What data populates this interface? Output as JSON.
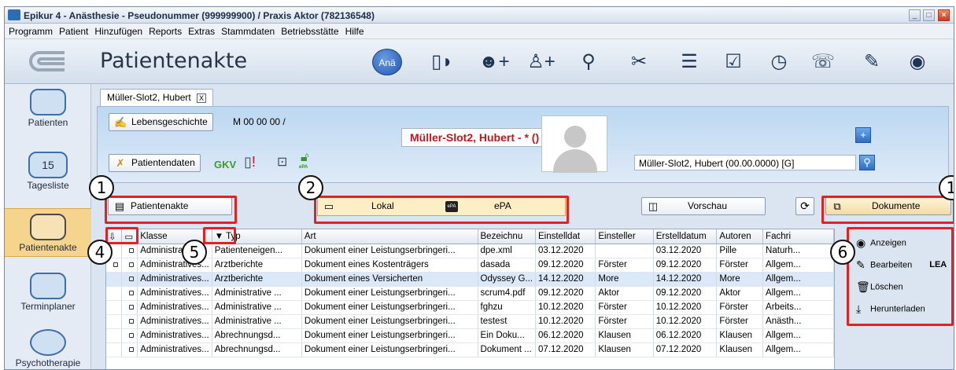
{
  "window": {
    "title": "Epikur 4 - Anästhesie - Pseudonummer (999999900) / Praxis Aktor (782136548)"
  },
  "menu": [
    "Programm",
    "Patient",
    "Hinzufügen",
    "Reports",
    "Extras",
    "Stammdaten",
    "Betriebsstätte",
    "Hilfe"
  ],
  "toolbar": {
    "title": "Patientenakte",
    "ana_label": "Anä",
    "calendar_day": "15"
  },
  "sidebar": [
    {
      "label": "Patienten"
    },
    {
      "label": "Tagesliste",
      "badge": "15"
    },
    {
      "label": "Patientenakte"
    },
    {
      "label": "Terminplaner"
    },
    {
      "label": "Psychotherapie"
    }
  ],
  "tab": {
    "label": "Müller-Slot2, Hubert",
    "close": "X"
  },
  "header": {
    "lebensgeschichte": "Lebensgeschichte",
    "mnum": "M 00 00 00 /",
    "patient_name": "Müller-Slot2, Hubert - * ()",
    "patientendaten": "Patientendaten",
    "gkv": "GKV",
    "selector": "Müller-Slot2, Hubert (00.00.0000) [G]",
    "plus": "+",
    "epa_icon": "ePA"
  },
  "buttons": {
    "patientenakte": "Patientenakte",
    "lokal": "Lokal",
    "epa": "ePA",
    "epa_icon": "ePA",
    "vorschau": "Vorschau",
    "dokumente": "Dokumente"
  },
  "callouts": [
    "1",
    "2",
    "1",
    "4",
    "5",
    "6"
  ],
  "table": {
    "headers": [
      "",
      "",
      "Klasse",
      "Typ",
      "Art",
      "Bezeichnu",
      "Einstelldat",
      "Einsteller",
      "Erstelldatum",
      "Autoren",
      "Fachri"
    ],
    "rows": [
      [
        "",
        "",
        "Administrat...",
        "Patienteneigen...",
        "Dokument einer Leistungserbringeri...",
        "dpe.xml",
        "03.12.2020",
        "",
        "03.12.2020",
        "Pille",
        "Naturh..."
      ],
      [
        "",
        "",
        "Administratives...",
        "Arztberichte",
        "Dokument eines Kostenträgers",
        "dasada",
        "09.12.2020",
        "Förster",
        "09.12.2020",
        "Förster",
        "Allgem..."
      ],
      [
        "",
        "",
        "Administratives...",
        "Arztberichte",
        "Dokument eines Versicherten",
        "Odyssey G...",
        "14.12.2020",
        "More",
        "14.12.2020",
        "More",
        "Allgem..."
      ],
      [
        "",
        "",
        "Administratives...",
        "Administrative ...",
        "Dokument einer Leistungserbringeri...",
        "scrum4.pdf",
        "09.12.2020",
        "Aktor",
        "09.12.2020",
        "Aktor",
        "Allgem..."
      ],
      [
        "",
        "",
        "Administratives...",
        "Administrative ...",
        "Dokument einer Leistungserbringeri...",
        "fghzu",
        "10.12.2020",
        "Förster",
        "10.12.2020",
        "Förster",
        "Arbeits..."
      ],
      [
        "",
        "",
        "Administratives...",
        "Administrative ...",
        "Dokument einer Leistungserbringeri...",
        "testest",
        "10.12.2020",
        "Förster",
        "10.12.2020",
        "Förster",
        "Anästh..."
      ],
      [
        "",
        "",
        "Administratives...",
        "Abrechnungsd...",
        "Dokument einer Leistungserbringeri...",
        "Ein Doku...",
        "06.12.2020",
        "Klausen",
        "06.12.2020",
        "Klausen",
        "Allgem..."
      ],
      [
        "",
        "",
        "Administratives...",
        "Abrechnungsd...",
        "Dokument einer Leistungserbringeri...",
        "Dokument ...",
        "07.12.2020",
        "Klausen",
        "07.12.2020",
        "Klausen",
        "Allgem..."
      ]
    ]
  },
  "panel": {
    "anzeigen": "Anzeigen",
    "bearbeiten": "Bearbeiten",
    "lea": "LEA",
    "loeschen": "Löschen",
    "herunterladen": "Herunterladen"
  }
}
